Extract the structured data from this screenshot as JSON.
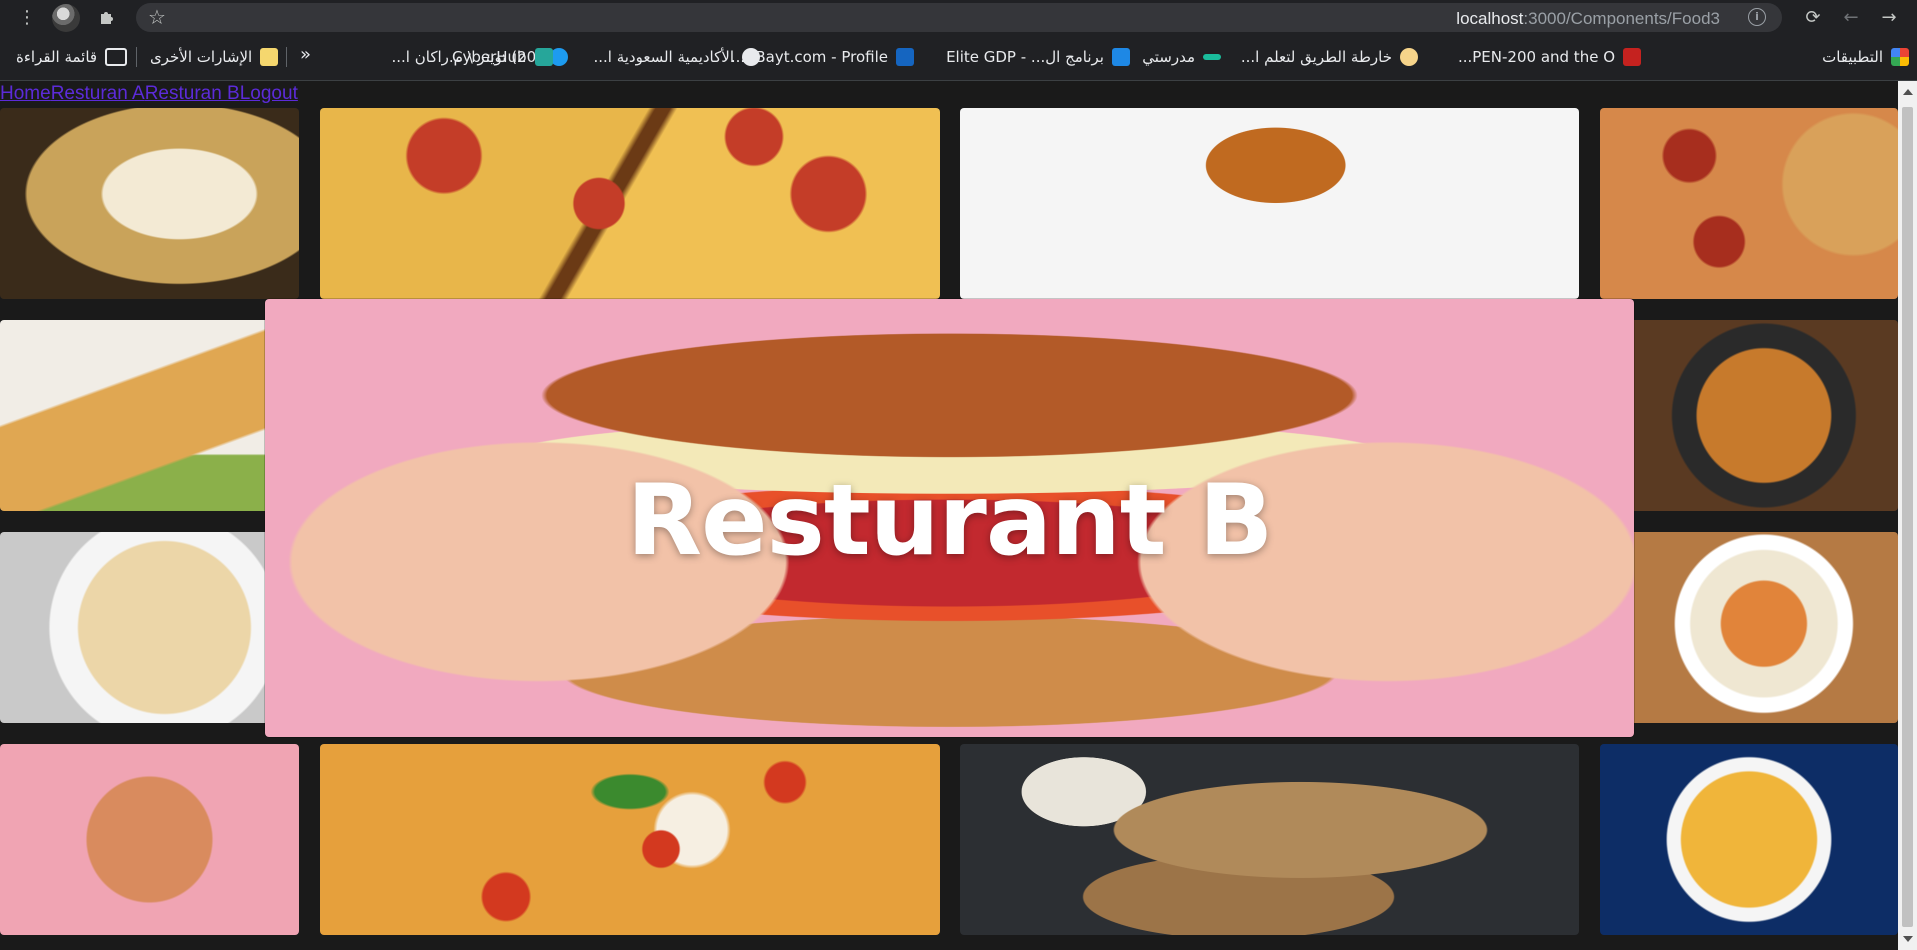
{
  "browser": {
    "url_host": "localhost",
    "url_path": ":3000/Components/Food3"
  },
  "bookmarks": [
    {
      "label": "التطبيقات",
      "icon": "apps-grid-icon",
      "color": "#e94235"
    },
    {
      "label": "PEN-200 and the O...",
      "icon": "offsec-icon",
      "color": "#c5221f"
    },
    {
      "label": "خارطة الطريق لتعلم ا...",
      "icon": "roadmap-icon",
      "color": "#f6d48a"
    },
    {
      "label": "مدرستي",
      "icon": "madrasati-icon",
      "color": "#1abc9c"
    },
    {
      "label": "برنامج ال... - Elite GDP",
      "icon": "elite-gdp-icon",
      "color": "#1e88e5"
    },
    {
      "label": "Bayt.com - Profile -...",
      "icon": "bayt-icon",
      "color": "#1565c0"
    },
    {
      "label": "الأكاديمية السعودية ا...",
      "icon": "globe-icon",
      "color": "#e8eaed"
    },
    {
      "label": "(20) تويتر \\ م.راكان ا...",
      "icon": "twitter-icon",
      "color": "#1d9bf0"
    },
    {
      "label": "CyberHub",
      "icon": "cyberhub-icon",
      "color": "#26a69a"
    }
  ],
  "other_bookmarks": "الإشارات الأخرى",
  "reading_list": "قائمة القراءة",
  "nav": {
    "home": "Home",
    "resturan_a": "Resturan A",
    "resturan_b": "Resturan B",
    "logout": "Logout"
  },
  "hero": {
    "title": "Resturant B"
  },
  "food_tiles": [
    {
      "name": "stuffed-pasta-shells",
      "color": "#c9a35a"
    },
    {
      "name": "pepperoni-pizza-slices",
      "color": "#d9732f"
    },
    {
      "name": "idli-sambar",
      "color": "#e9e4d8"
    },
    {
      "name": "pepperoni-pizza-roll",
      "color": "#c4653a"
    },
    {
      "name": "dosa",
      "color": "#e0a752"
    },
    {
      "name": "biryani",
      "color": "#b86a2a"
    },
    {
      "name": "shrimp-spaghetti",
      "color": "#e8d3a8"
    },
    {
      "name": "butter-chicken-rice",
      "color": "#b57a44"
    },
    {
      "name": "heart-pizza",
      "color": "#f0a4b3"
    },
    {
      "name": "margherita-pizza",
      "color": "#e6a03c"
    },
    {
      "name": "samosa",
      "color": "#6b5a45"
    },
    {
      "name": "fried-dough-balls",
      "color": "#e8a430"
    }
  ]
}
